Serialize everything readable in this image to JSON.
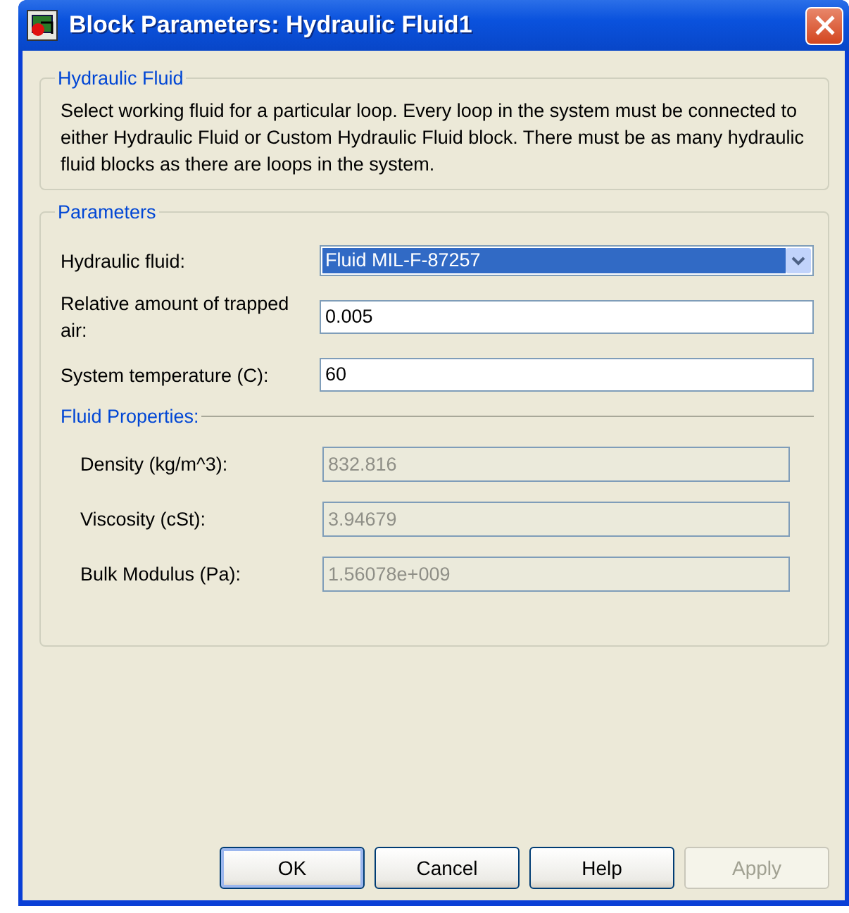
{
  "window": {
    "title": "Block Parameters: Hydraulic Fluid1"
  },
  "description_group": {
    "title": "Hydraulic Fluid",
    "text": "Select working fluid for a particular loop. Every loop in the system must be connected to either Hydraulic Fluid or Custom Hydraulic Fluid block. There must be as many hydraulic fluid blocks as there are loops in the system."
  },
  "parameters": {
    "title": "Parameters",
    "fields": [
      {
        "kind": "dropdown",
        "label": "Hydraulic fluid:",
        "value": "Fluid MIL-F-87257",
        "focused": true
      },
      {
        "kind": "text",
        "label": "Relative amount of trapped air:",
        "value": "0.005",
        "focused": false
      },
      {
        "kind": "text",
        "label": "System temperature (C):",
        "value": "60",
        "focused": false
      }
    ],
    "fluid_properties": {
      "title": "Fluid Properties:",
      "fields": [
        {
          "label": "Density (kg/m^3):",
          "value": "832.816",
          "disabled": true
        },
        {
          "label": "Viscosity (cSt):",
          "value": "3.94679",
          "disabled": true
        },
        {
          "label": "Bulk Modulus (Pa):",
          "value": "1.56078e+009",
          "disabled": true
        }
      ]
    }
  },
  "buttons": [
    {
      "label": "OK",
      "default": true,
      "disabled": false
    },
    {
      "label": "Cancel",
      "default": false,
      "disabled": false
    },
    {
      "label": "Help",
      "default": false,
      "disabled": false
    },
    {
      "label": "Apply",
      "default": false,
      "disabled": true
    }
  ]
}
